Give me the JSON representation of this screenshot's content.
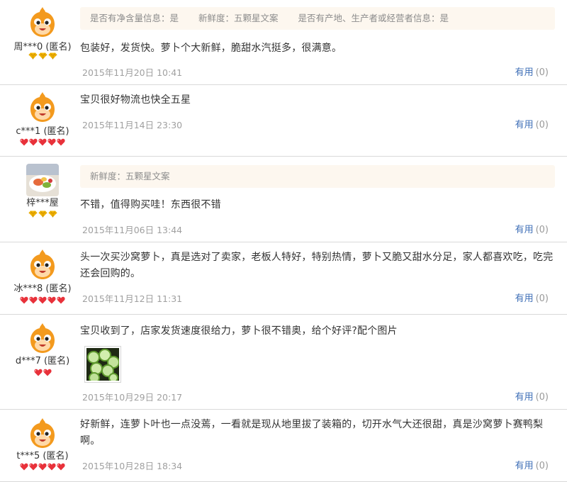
{
  "reviews": [
    {
      "user": "周***0 (匿名)",
      "avatar": "taobao-mascot",
      "rank_icon": "gold-diamond",
      "attrs": [
        "是否有净含量信息：是",
        "新鲜度：五颗星文案",
        "是否有产地、生产者或经营者信息：是"
      ],
      "content": "包装好，发货快。萝卜个大新鲜，脆甜水汽挺多，很满意。",
      "date": "2015年11月20日 10:41",
      "useful_label": "有用",
      "useful_count": "(0)"
    },
    {
      "user": "c***1 (匿名)",
      "avatar": "taobao-mascot",
      "rank_icon": "red-heart",
      "attrs": [],
      "content": "宝贝很好物流也快全五星",
      "date": "2015年11月14日 23:30",
      "useful_label": "有用",
      "useful_count": "(0)"
    },
    {
      "user": "梓***屋",
      "avatar": "food-photo",
      "rank_icon": "gold-diamond",
      "attrs": [
        "新鲜度：五颗星文案"
      ],
      "content": "不错，值得购买哇！东西很不错",
      "date": "2015年11月06日 13:44",
      "useful_label": "有用",
      "useful_count": "(0)"
    },
    {
      "user": "冰***8 (匿名)",
      "avatar": "taobao-mascot",
      "rank_icon": "red-heart",
      "attrs": [],
      "content": "头一次买沙窝萝卜，真是选对了卖家，老板人特好，特别热情，萝卜又脆又甜水分足，家人都喜欢吃，吃完还会回购的。",
      "date": "2015年11月12日 11:31",
      "useful_label": "有用",
      "useful_count": "(0)"
    },
    {
      "user": "d***7 (匿名)",
      "avatar": "taobao-mascot",
      "rank_icon": "red-heart",
      "attrs": [],
      "content": "宝贝收到了，店家发货速度很给力，萝卜很不错奥，给个好评?配个图片",
      "date": "2015年10月29日 20:17",
      "useful_label": "有用",
      "useful_count": "(0)"
    },
    {
      "user": "t***5 (匿名)",
      "avatar": "taobao-mascot",
      "rank_icon": "red-heart",
      "attrs": [],
      "content": "好新鲜，连萝卜叶也一点没蔫，一看就是现从地里拔了装箱的，切开水气大还很甜，真是沙窝萝卜赛鸭梨啊。",
      "date": "2015年10月28日 18:34",
      "useful_label": "有用",
      "useful_count": "(0)"
    }
  ],
  "rank_counts": [
    3,
    5,
    3,
    5,
    2,
    5
  ],
  "colors": {
    "link": "#3f6fb7",
    "date": "#a0a0a0",
    "attr_bg": "#fdf7ef",
    "mascot": "#f39a1e",
    "heart": "#e8313a",
    "diamond": "#f5b800"
  }
}
